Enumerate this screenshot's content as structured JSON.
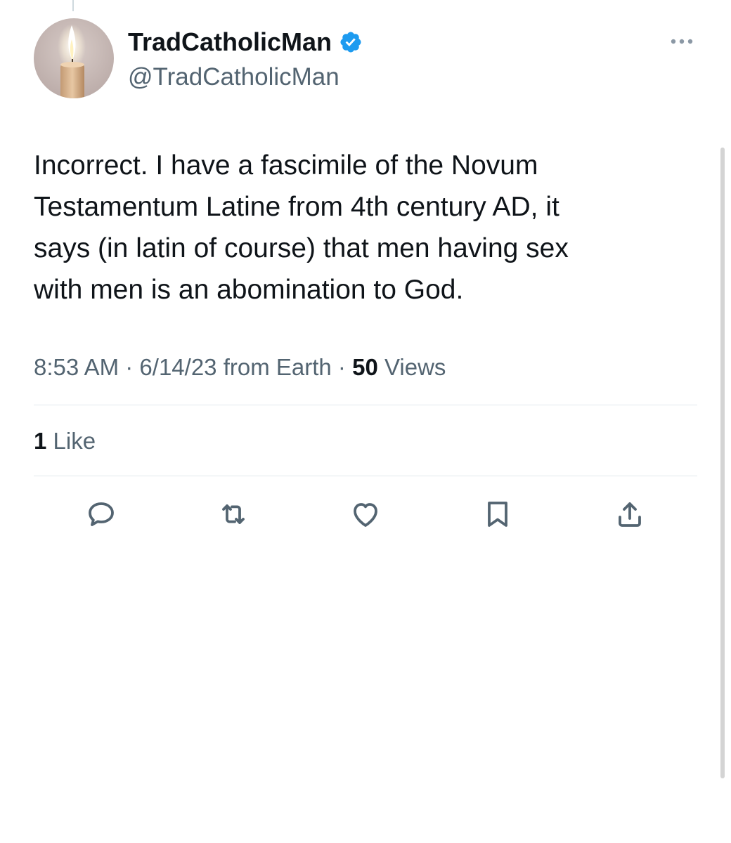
{
  "tweet": {
    "display_name": "TradCatholicMan",
    "handle": "@TradCatholicMan",
    "verified": true,
    "text": "Incorrect. I have a fascimile of the Novum\nTestamentum Latine from 4th century AD, it\nsays (in latin of course) that men having sex\nwith men is an abomination to God.",
    "time": "8:53 AM",
    "date": "6/14/23",
    "source": "from Earth",
    "views_count": "50",
    "views_label": "Views",
    "likes_count": "1",
    "likes_label": "Like"
  },
  "icons": {
    "avatar": "candle-avatar",
    "verified": "verified-badge-icon",
    "more": "more-dots-icon",
    "actions": [
      "reply-icon",
      "retweet-icon",
      "like-icon",
      "bookmark-icon",
      "share-icon"
    ]
  },
  "colors": {
    "text": "#0f1419",
    "secondary": "#536471",
    "verified": "#1d9bf0",
    "divider": "#e1e8ed"
  }
}
